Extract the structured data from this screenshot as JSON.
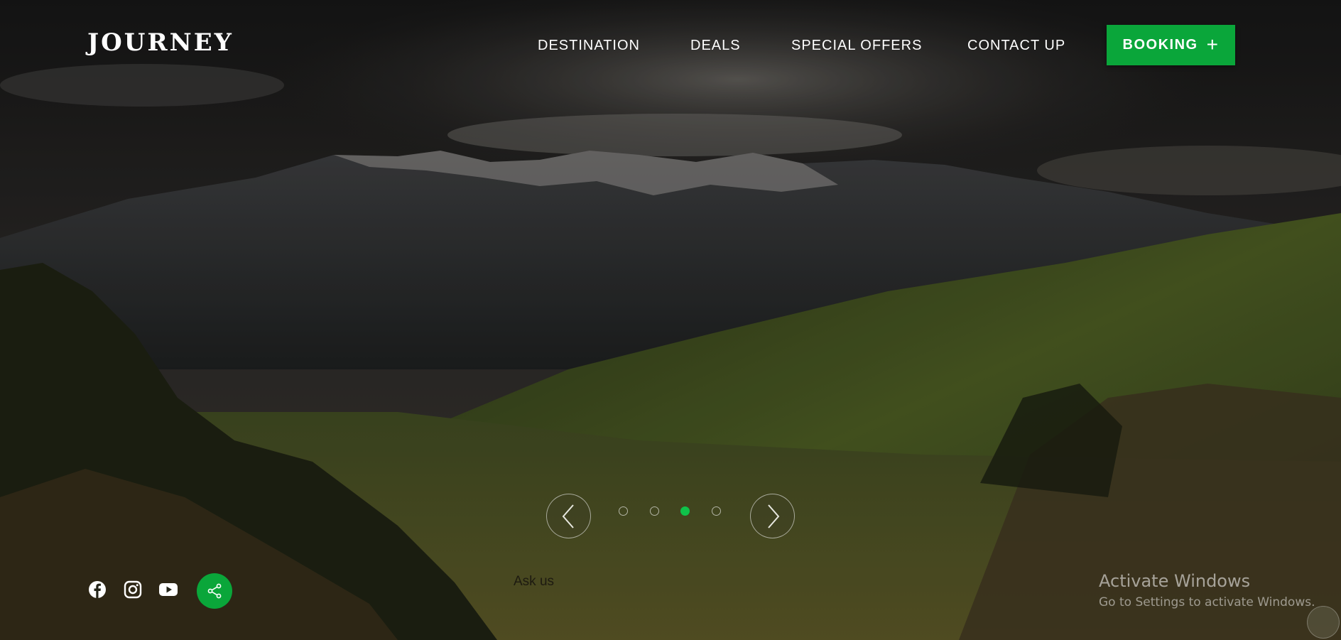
{
  "brand": {
    "logo_text": "JOURNEY"
  },
  "nav": {
    "items": [
      {
        "label": "DESTINATION"
      },
      {
        "label": "DEALS"
      },
      {
        "label": "SPECIAL OFFERS"
      },
      {
        "label": "CONTACT UP"
      }
    ],
    "booking_label": "BOOKING",
    "booking_icon": "plus-icon",
    "accent_color": "#0aa63a"
  },
  "slider": {
    "prev_icon": "chevron-left-icon",
    "next_icon": "chevron-right-icon",
    "dot_count": 4,
    "active_dot": 3
  },
  "social": {
    "icons": [
      "facebook-icon",
      "instagram-icon",
      "youtube-icon",
      "share-icon"
    ]
  },
  "ask_us_label": "Ask us",
  "watermark": {
    "title": "Activate Windows",
    "subtitle": "Go to Settings to activate Windows."
  }
}
